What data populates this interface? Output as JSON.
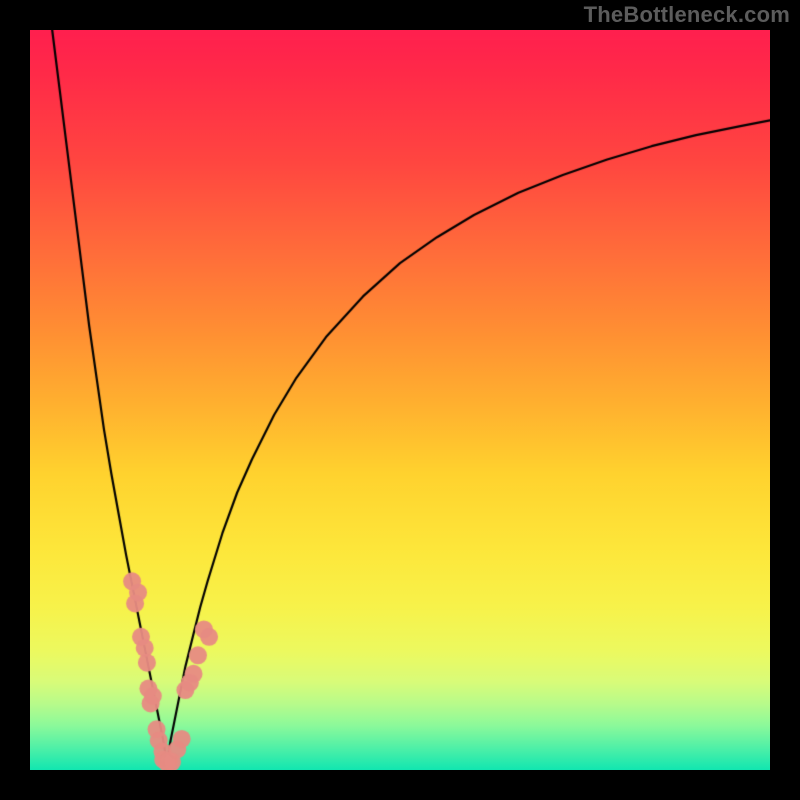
{
  "watermark": "TheBottleneck.com",
  "chart_data": {
    "type": "line",
    "title": "",
    "xlabel": "",
    "ylabel": "",
    "xlim": [
      0,
      100
    ],
    "ylim": [
      0,
      100
    ],
    "grid": false,
    "legend": false,
    "minimum_x": 18.5,
    "curve": {
      "name": "bottleneck-curve",
      "color": "#000000",
      "x": [
        3,
        4,
        5,
        6,
        7,
        8,
        9,
        10,
        11,
        12,
        13,
        14,
        15,
        15.5,
        16,
        16.5,
        17,
        17.5,
        18,
        18.25,
        18.5,
        18.75,
        19,
        19.5,
        20,
        20.5,
        21,
        22,
        23,
        24,
        26,
        28,
        30,
        33,
        36,
        40,
        45,
        50,
        55,
        60,
        66,
        72,
        78,
        84,
        90,
        96,
        100
      ],
      "y": [
        100,
        92,
        84,
        76,
        68,
        60,
        53,
        46,
        40,
        34.5,
        29,
        24,
        19,
        16.5,
        14,
        11.5,
        9,
        6.5,
        4,
        2.5,
        1.2,
        2.5,
        4,
        6.5,
        9,
        11.5,
        14,
        18,
        22,
        25.5,
        32,
        37.5,
        42,
        48,
        53,
        58.5,
        64,
        68.5,
        72,
        75,
        78,
        80.4,
        82.5,
        84.3,
        85.8,
        87,
        87.8
      ]
    },
    "markers": {
      "name": "data-points",
      "color": "#e78b83",
      "radius": 9,
      "points": [
        [
          13.8,
          25.5
        ],
        [
          14.2,
          22.5
        ],
        [
          14.6,
          24.0
        ],
        [
          15.0,
          18.0
        ],
        [
          15.5,
          16.5
        ],
        [
          15.8,
          14.5
        ],
        [
          16.0,
          11.0
        ],
        [
          16.3,
          9.0
        ],
        [
          16.6,
          10.0
        ],
        [
          17.1,
          5.5
        ],
        [
          17.4,
          4.0
        ],
        [
          17.9,
          2.5
        ],
        [
          18.0,
          1.4
        ],
        [
          18.5,
          1.0
        ],
        [
          18.8,
          1.2
        ],
        [
          19.2,
          1.1
        ],
        [
          19.9,
          2.8
        ],
        [
          20.5,
          4.2
        ],
        [
          21.0,
          10.8
        ],
        [
          21.6,
          11.8
        ],
        [
          22.1,
          13.0
        ],
        [
          22.7,
          15.5
        ],
        [
          23.5,
          19.0
        ],
        [
          24.2,
          18.0
        ]
      ]
    }
  }
}
